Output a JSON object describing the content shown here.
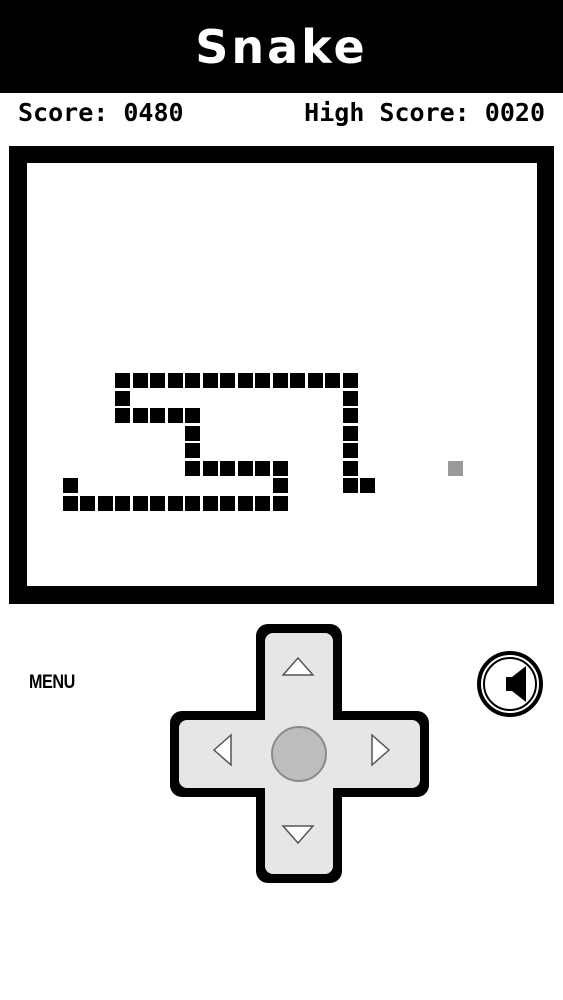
{
  "header": {
    "title": "Snake"
  },
  "scoreboard": {
    "score_label": "Score: 0480",
    "high_score_label": "High Score: 0020"
  },
  "game": {
    "grid_step": 17.5,
    "snake_color": "#000000",
    "food_color": "#9a9a9a",
    "snake": [
      {
        "col": 4,
        "row": 12
      },
      {
        "col": 5,
        "row": 12
      },
      {
        "col": 6,
        "row": 12
      },
      {
        "col": 7,
        "row": 12
      },
      {
        "col": 8,
        "row": 12
      },
      {
        "col": 9,
        "row": 12
      },
      {
        "col": 10,
        "row": 12
      },
      {
        "col": 11,
        "row": 12
      },
      {
        "col": 12,
        "row": 12
      },
      {
        "col": 13,
        "row": 12
      },
      {
        "col": 14,
        "row": 12
      },
      {
        "col": 15,
        "row": 12
      },
      {
        "col": 16,
        "row": 12
      },
      {
        "col": 17,
        "row": 12
      },
      {
        "col": 4,
        "row": 13
      },
      {
        "col": 4,
        "row": 14
      },
      {
        "col": 5,
        "row": 14
      },
      {
        "col": 6,
        "row": 14
      },
      {
        "col": 7,
        "row": 14
      },
      {
        "col": 8,
        "row": 14
      },
      {
        "col": 8,
        "row": 15
      },
      {
        "col": 8,
        "row": 16
      },
      {
        "col": 8,
        "row": 17
      },
      {
        "col": 9,
        "row": 17
      },
      {
        "col": 10,
        "row": 17
      },
      {
        "col": 11,
        "row": 17
      },
      {
        "col": 12,
        "row": 17
      },
      {
        "col": 13,
        "row": 17
      },
      {
        "col": 13,
        "row": 18
      },
      {
        "col": 13,
        "row": 19
      },
      {
        "col": 12,
        "row": 19
      },
      {
        "col": 11,
        "row": 19
      },
      {
        "col": 10,
        "row": 19
      },
      {
        "col": 9,
        "row": 19
      },
      {
        "col": 8,
        "row": 19
      },
      {
        "col": 7,
        "row": 19
      },
      {
        "col": 6,
        "row": 19
      },
      {
        "col": 5,
        "row": 19
      },
      {
        "col": 4,
        "row": 19
      },
      {
        "col": 3,
        "row": 19
      },
      {
        "col": 2,
        "row": 19
      },
      {
        "col": 1,
        "row": 19
      },
      {
        "col": 1,
        "row": 18
      },
      {
        "col": 17,
        "row": 13
      },
      {
        "col": 17,
        "row": 14
      },
      {
        "col": 17,
        "row": 15
      },
      {
        "col": 17,
        "row": 16
      },
      {
        "col": 17,
        "row": 17
      },
      {
        "col": 17,
        "row": 18
      },
      {
        "col": 18,
        "row": 18
      }
    ],
    "food": {
      "col": 23,
      "row": 17
    }
  },
  "controls": {
    "menu_label": "MENU",
    "dpad_fill": "#e6e6e6",
    "center_button_fill": "#bdbdbd",
    "arrow_icons": [
      "up-arrow-icon",
      "down-arrow-icon",
      "left-arrow-icon",
      "right-arrow-icon"
    ],
    "sound_icon": "speaker-icon"
  }
}
